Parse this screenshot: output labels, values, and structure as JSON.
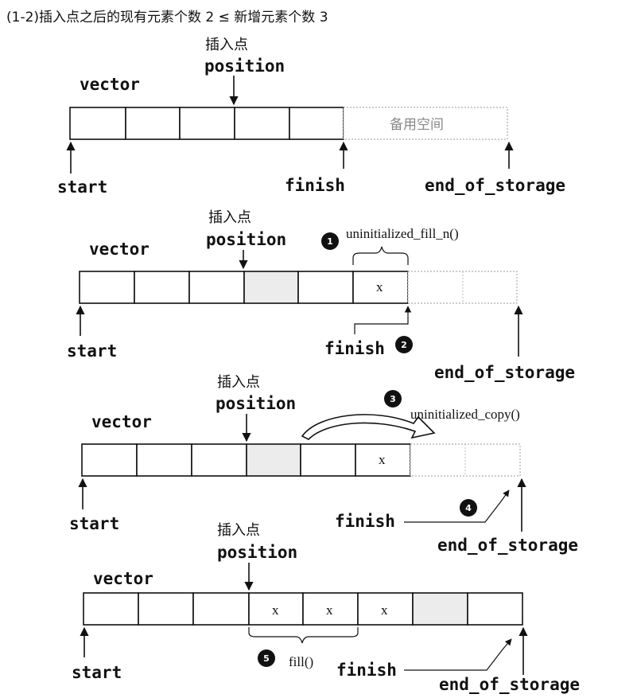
{
  "title": "(1-2)插入点之后的现有元素个数 2 ≤ 新增元素个数 3",
  "labels": {
    "vector": "vector",
    "insert_point": "插入点",
    "position": "position",
    "start": "start",
    "finish": "finish",
    "end_of_storage": "end_of_storage",
    "spare_space": "备用空间",
    "x": "x"
  },
  "steps": [
    {
      "num": "1",
      "func": "uninitialized_fill_n()"
    },
    {
      "num": "2",
      "func": ""
    },
    {
      "num": "3",
      "func": "uninitialized_copy()"
    },
    {
      "num": "4",
      "func": ""
    },
    {
      "num": "5",
      "func": "fill()"
    }
  ]
}
